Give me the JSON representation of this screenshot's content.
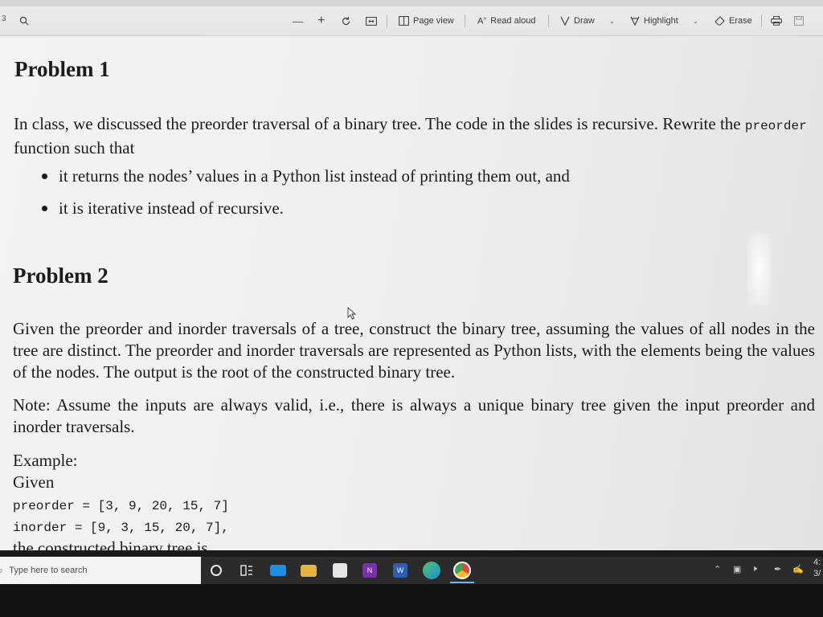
{
  "toolbar": {
    "page_number": "3",
    "minus": "—",
    "plus": "+",
    "page_view": "Page view",
    "read_aloud": "Read aloud",
    "draw": "Draw",
    "highlight": "Highlight",
    "erase": "Erase"
  },
  "document": {
    "problem1": {
      "heading": "Problem 1",
      "para_pre": "In class, we discussed the preorder traversal of a binary tree. The code in the slides is recursive. Rewrite the",
      "para_code": "preorder",
      "para_post": "function such that",
      "bullets": [
        "it returns the nodes’ values in a Python list instead of printing them out, and",
        "it is iterative instead of recursive."
      ]
    },
    "problem2": {
      "heading": "Problem 2",
      "para": "Given the preorder and inorder traversals of a tree, construct the binary tree, assuming the values of all nodes in the tree are distinct. The preorder and inorder traversals are represented as Python lists, with the elements being the values of the nodes. The output is the root of the constructed binary tree.",
      "note": "Note: Assume the inputs are always valid, i.e., there is always a unique binary tree given the input preorder and inorder traversals.",
      "example_label": "Example:",
      "given_label": "Given",
      "preorder_line": "preorder = [3, 9, 20, 15, 7]",
      "inorder_line": "inorder = [9, 3, 15, 20, 7],",
      "cutoff_line": "the constructed binary tree is"
    }
  },
  "taskbar": {
    "search_placeholder": "Type here to search",
    "tray_time_partial": "4:",
    "tray_date_partial": "3/"
  }
}
